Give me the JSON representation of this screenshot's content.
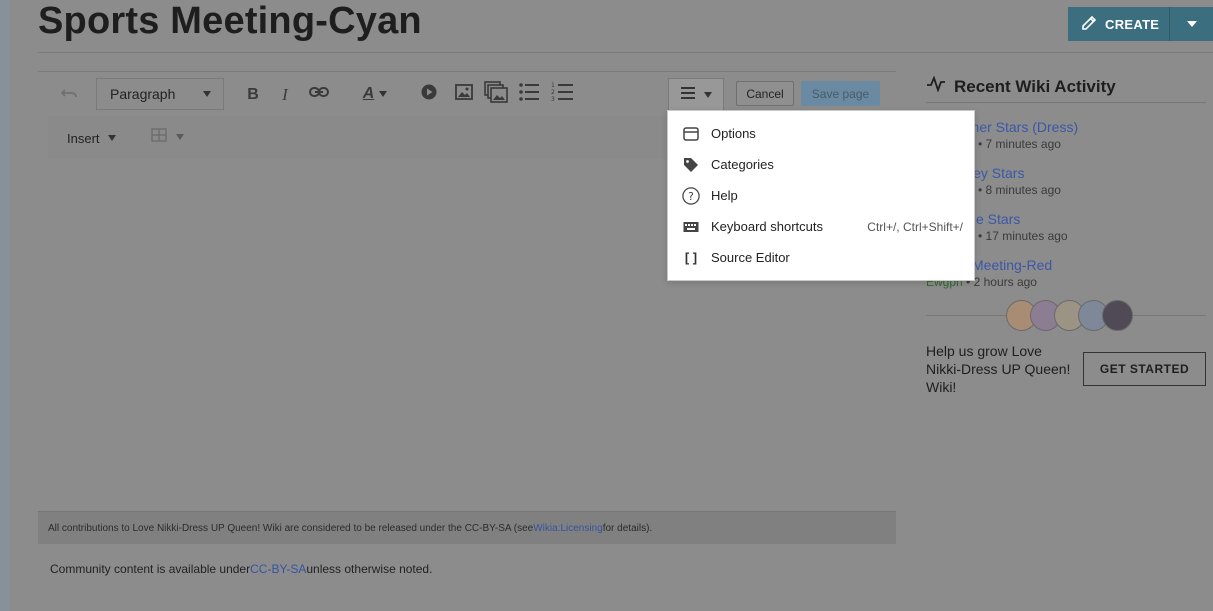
{
  "header": {
    "title": "Sports Meeting-Cyan",
    "create_label": "CREATE"
  },
  "toolbar": {
    "format_select": "Paragraph",
    "insert_label": "Insert",
    "cancel_label": "Cancel",
    "save_label": "Save page"
  },
  "menu": {
    "items": [
      {
        "label": "Options",
        "icon": "options-icon",
        "shortcut": ""
      },
      {
        "label": "Categories",
        "icon": "tag-icon",
        "shortcut": ""
      },
      {
        "label": "Help",
        "icon": "help-icon",
        "shortcut": ""
      },
      {
        "label": "Keyboard shortcuts",
        "icon": "keyboard-icon",
        "shortcut": "Ctrl+/, Ctrl+Shift+/"
      },
      {
        "label": "Source Editor",
        "icon": "source-icon",
        "shortcut": ""
      }
    ],
    "source_icon_glyph": "[ ]"
  },
  "footer": {
    "license_text_1": "All contributions to Love Nikki-Dress UP Queen! Wiki are considered to be released under the CC-BY-SA (see ",
    "license_link": "Wikia:Licensing",
    "license_text_2": " for details).",
    "community_text_1": "Community content is available under ",
    "community_link": "CC-BY-SA",
    "community_text_2": " unless otherwise noted."
  },
  "rail": {
    "title": "Recent Wiki Activity",
    "activities": [
      {
        "title": "mmer Stars (Dress)",
        "meta": "• 7 minutes ago"
      },
      {
        "title": "ley Stars",
        "meta": "• 8 minutes ago"
      },
      {
        "title": "e Stars",
        "meta": "• 17 minutes ago"
      },
      {
        "title": "Meeting-Red",
        "user": "Ewgph",
        "meta": "• 2 hours ago"
      }
    ],
    "grow_text": "Help us grow Love Nikki-Dress UP Queen! Wiki!",
    "get_started_label": "GET STARTED"
  },
  "colors": {
    "accent": "#3b6f80",
    "link": "#3554a0",
    "overlay_bg": "#8c8c8c"
  }
}
